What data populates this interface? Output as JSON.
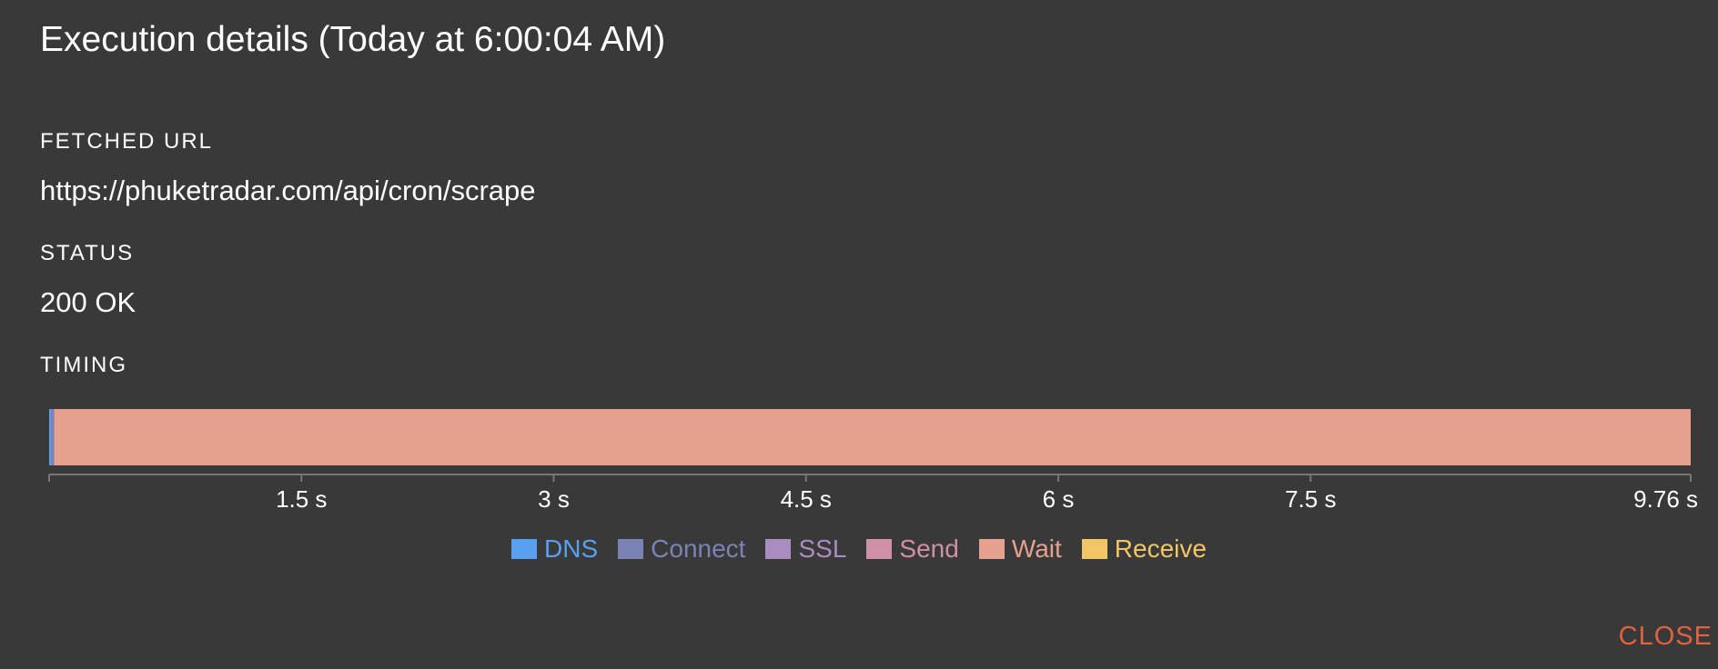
{
  "dialog": {
    "title": "Execution details (Today at 6:00:04 AM)",
    "fetched_url_label": "FETCHED URL",
    "fetched_url": "https://phuketradar.com/api/cron/scrape",
    "status_label": "STATUS",
    "status": "200 OK",
    "timing_label": "TIMING",
    "close_label": "CLOSE"
  },
  "colors": {
    "background": "#393939",
    "dns": "#5aa0f0",
    "connect": "#7b83b6",
    "ssl": "#a98cc0",
    "send": "#d08fa8",
    "wait": "#e6a08f",
    "receive": "#f2c565",
    "close": "#e0623e",
    "axis": "#777777"
  },
  "chart_data": {
    "type": "bar",
    "orientation": "horizontal-stacked",
    "unit": "s",
    "xlim": [
      0,
      9.76
    ],
    "ticks": [
      {
        "value": 1.5,
        "label": "1.5 s"
      },
      {
        "value": 3,
        "label": "3 s"
      },
      {
        "value": 4.5,
        "label": "4.5 s"
      },
      {
        "value": 6,
        "label": "6 s"
      },
      {
        "value": 7.5,
        "label": "7.5 s"
      },
      {
        "value": 9.76,
        "label": "9.76 s"
      }
    ],
    "series": [
      {
        "name": "DNS",
        "key": "dns",
        "value": 0.01
      },
      {
        "name": "Connect",
        "key": "connect",
        "value": 0.02
      },
      {
        "name": "SSL",
        "key": "ssl",
        "value": 0
      },
      {
        "name": "Send",
        "key": "send",
        "value": 0
      },
      {
        "name": "Wait",
        "key": "wait",
        "value": 9.73
      },
      {
        "name": "Receive",
        "key": "receive",
        "value": 0
      }
    ],
    "legend_position": "bottom"
  }
}
